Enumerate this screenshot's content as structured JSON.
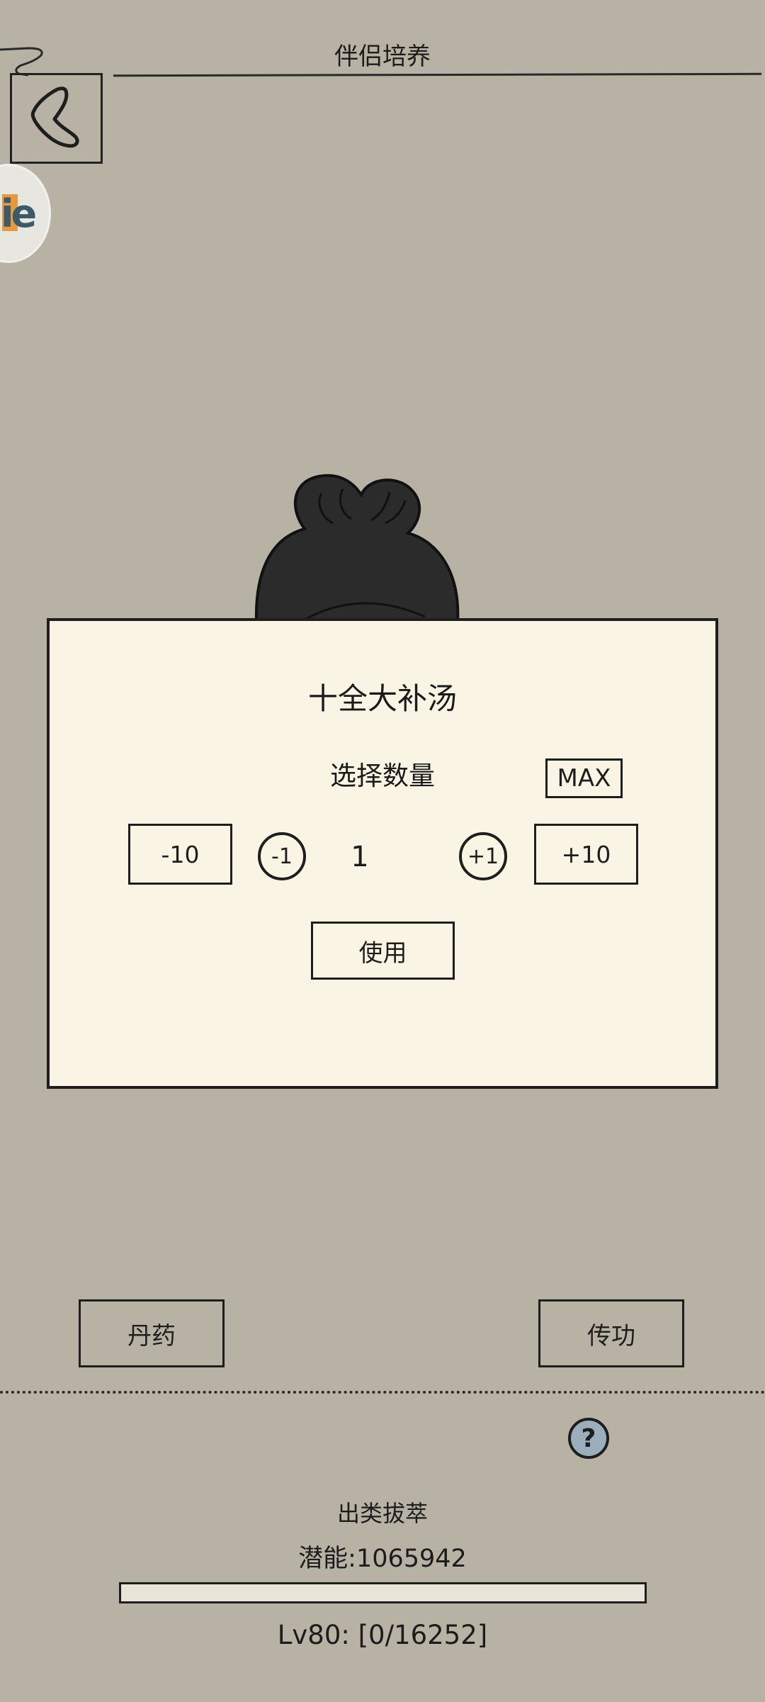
{
  "header": {
    "title": "伴侣培养"
  },
  "side_badge": {
    "icon": "app-logo",
    "accent": "#e79a3c",
    "text_color": "#3c5a6a"
  },
  "dialog": {
    "title": "十全大补汤",
    "quantity_label": "选择数量",
    "max_label": "MAX",
    "minus10_label": "-10",
    "minus1_label": "-1",
    "quantity_value": "1",
    "plus1_label": "+1",
    "plus10_label": "+10",
    "use_label": "使用"
  },
  "actions": {
    "pill_label": "丹药",
    "transfer_label": "传功"
  },
  "help": {
    "label": "?"
  },
  "status": {
    "rank": "出类拔萃",
    "potential": "潜能:1065942",
    "level": "Lv80: [0/16252]",
    "progress_fraction": 0
  },
  "colors": {
    "background": "#b8b2a4",
    "dialog_bg": "#faf4e5",
    "help_icon_bg": "#9aaebb"
  }
}
